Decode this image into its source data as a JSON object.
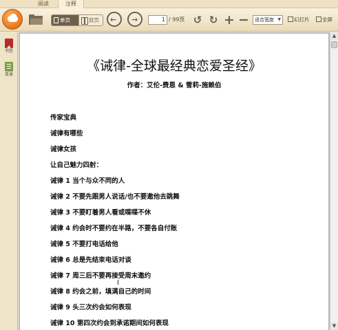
{
  "tabs": [
    {
      "label": "阅读"
    },
    {
      "label": "注释"
    }
  ],
  "toolbar": {
    "single_page_label": "单页",
    "double_page_label": "双页",
    "page_current": "1",
    "page_total": "/ 99页",
    "zoom_value": "适合宽度",
    "slideshow_label": "幻灯片",
    "fullscreen_label": "全屏"
  },
  "rail": {
    "bookmark_label": "书签",
    "toc_label": "目录"
  },
  "document": {
    "title": "《诫律-全球最经典恋爱圣经》",
    "author": "作者：艾伦-费恩 & 雪莉-施赖伯",
    "lines": [
      "传家宝典",
      "诫律有哪些",
      "诫律女孩",
      "让自己魅力四射：",
      "诫律 1  当个与众不同的人",
      "诫律 2  不要先跟男人说话/也不要邀他去跳舞",
      "诫律 3  不要盯着男人看或喋喋不休",
      "诫律 4  约会时不要约在半路，不要各自付账",
      "诫律 5  不要打电话给他",
      "诫律 6  总是先结束电话对谈",
      "诫律 7  周三后不要再接受周末邀约",
      "诫律 8  约会之前，填满自己的时间",
      "诫律 9  头三次约会如何表现",
      "诫律 10  第四次约会到承诺期间如何表现"
    ]
  }
}
